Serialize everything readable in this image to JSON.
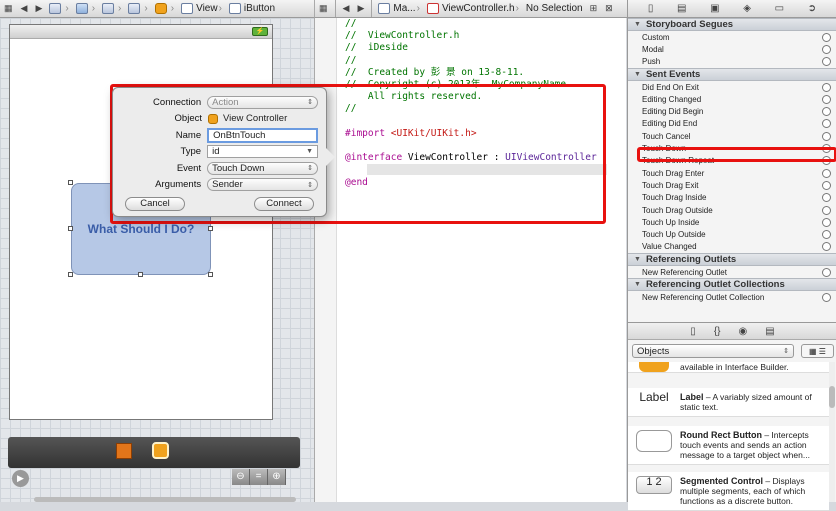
{
  "canvas_jumpbar": {
    "crumbs": [
      "View",
      "iButton"
    ]
  },
  "editor_jumpbar": {
    "crumbs": [
      "Ma...",
      "ViewController.h",
      "No Selection"
    ]
  },
  "code": {
    "lines": [
      "//",
      "//  ViewController.h",
      "//  iDeside",
      "//",
      "//  Created by 彭 景 on 13-8-11.",
      "//  Copyright (c) 2013年  MyCompanyName . ",
      "    All rights reserved.",
      "//",
      "",
      "#import <UIKit/UIKit.h>",
      "",
      "@interface ViewController : UIViewController",
      "",
      "@end"
    ]
  },
  "canvas": {
    "button_title": "What Should I Do?",
    "battery_glyph": "⚡"
  },
  "popover": {
    "connection_label": "Connection",
    "connection_value": "Action",
    "object_label": "Object",
    "object_value": "View Controller",
    "name_label": "Name",
    "name_value": "OnBtnTouch",
    "type_label": "Type",
    "type_value": "id",
    "event_label": "Event",
    "event_value": "Touch Down",
    "arguments_label": "Arguments",
    "arguments_value": "Sender",
    "cancel_label": "Cancel",
    "connect_label": "Connect"
  },
  "inspector": {
    "storyboard_segues_title": "Storyboard Segues",
    "storyboard_segues": [
      "Custom",
      "Modal",
      "Push"
    ],
    "sent_events_title": "Sent Events",
    "sent_events": [
      "Did End On Exit",
      "Editing Changed",
      "Editing Did Begin",
      "Editing Did End",
      "Touch Cancel",
      "Touch Down",
      "Touch Down Repeat",
      "Touch Drag Enter",
      "Touch Drag Exit",
      "Touch Drag Inside",
      "Touch Drag Outside",
      "Touch Up Inside",
      "Touch Up Outside",
      "Value Changed"
    ],
    "referencing_outlets_title": "Referencing Outlets",
    "referencing_outlets": [
      "New Referencing Outlet"
    ],
    "outlet_collections_title": "Referencing Outlet Collections",
    "outlet_collections": [
      "New Referencing Outlet Collection"
    ]
  },
  "library": {
    "filter_value": "Objects",
    "items": [
      {
        "thumb": "",
        "title": "",
        "desc": "available in Interface Builder."
      },
      {
        "thumb": "Label",
        "title": "Label",
        "desc": " – A variably sized amount of static text."
      },
      {
        "thumb": "",
        "title": "Round Rect Button",
        "desc": " – Intercepts touch events and sends an action message to a target object when..."
      },
      {
        "thumb": "1 2",
        "title": "Segmented Control",
        "desc": " – Displays multiple segments, each of which functions as a discrete button."
      }
    ]
  },
  "colors": {
    "highlight_red": "#e8110f",
    "button_fill": "#b6c8e6",
    "button_text": "#3a5da8"
  }
}
